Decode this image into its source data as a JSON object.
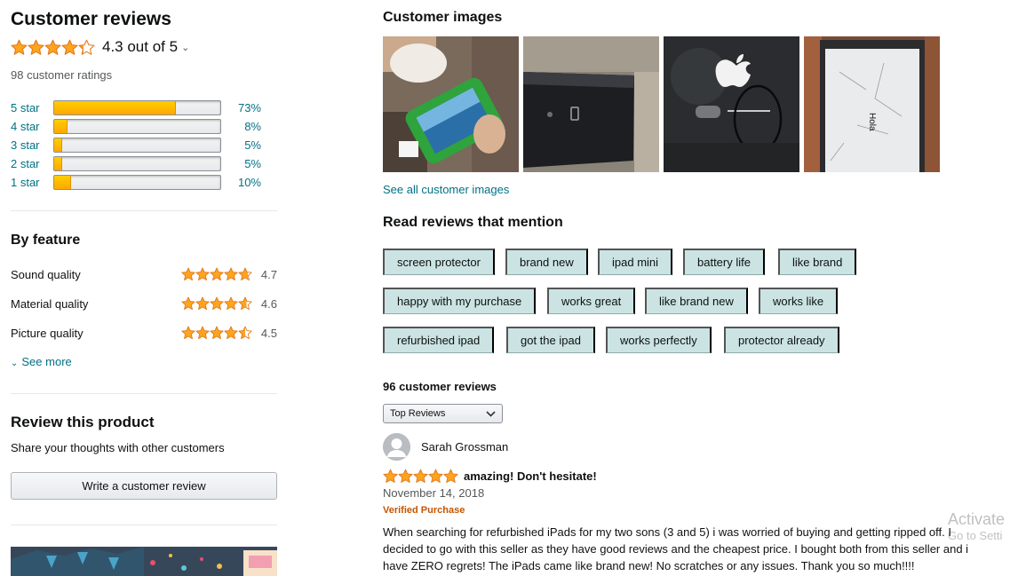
{
  "reviews_summary": {
    "heading": "Customer reviews",
    "overall_rating": 4.3,
    "overall_text": "4.3 out of 5",
    "ratings_count": "98 customer ratings",
    "histogram": [
      {
        "label": "5 star",
        "percent": 73,
        "percent_label": "73%"
      },
      {
        "label": "4 star",
        "percent": 8,
        "percent_label": "8%"
      },
      {
        "label": "3 star",
        "percent": 5,
        "percent_label": "5%"
      },
      {
        "label": "2 star",
        "percent": 5,
        "percent_label": "5%"
      },
      {
        "label": "1 star",
        "percent": 10,
        "percent_label": "10%"
      }
    ]
  },
  "by_feature": {
    "heading": "By feature",
    "features": [
      {
        "name": "Sound quality",
        "rating": 4.7,
        "rating_label": "4.7"
      },
      {
        "name": "Material quality",
        "rating": 4.6,
        "rating_label": "4.6"
      },
      {
        "name": "Picture quality",
        "rating": 4.5,
        "rating_label": "4.5"
      }
    ],
    "see_more": "See more"
  },
  "review_product": {
    "heading": "Review this product",
    "subtext": "Share your thoughts with other customers",
    "button": "Write a customer review"
  },
  "customer_images": {
    "heading": "Customer images",
    "see_all": "See all customer images",
    "image_4_text": "Hola"
  },
  "mentions": {
    "heading": "Read reviews that mention",
    "chips": [
      "screen protector",
      "brand new",
      "ipad mini",
      "battery life",
      "like brand",
      "happy with my purchase",
      "works great",
      "like brand new",
      "works like",
      "refurbished ipad",
      "got the ipad",
      "works perfectly",
      "protector already"
    ]
  },
  "review_list": {
    "count": "96 customer reviews",
    "sort_selected": "Top Reviews"
  },
  "review": {
    "author": "Sarah Grossman",
    "rating": 5,
    "title": "amazing! Don't hesitate!",
    "date": "November 14, 2018",
    "verified": "Verified Purchase",
    "body": "When searching for refurbished iPads for my two sons (3 and 5) i was worried of buying and getting ripped off. I decided to go with this seller as they have good reviews and the cheapest price. I bought both from this seller and i have ZERO regrets! The iPads came like brand new! No scratches or any issues. Thank you so much!!!!"
  },
  "watermark": {
    "line1": "Activate",
    "line2": "Go to Setti"
  },
  "colors": {
    "star": "#ffa41c",
    "star_outline": "#de7921",
    "link": "#007185",
    "bar_fill": "#ffa700",
    "chip": "#cbe3e3",
    "verified": "#c45500"
  }
}
